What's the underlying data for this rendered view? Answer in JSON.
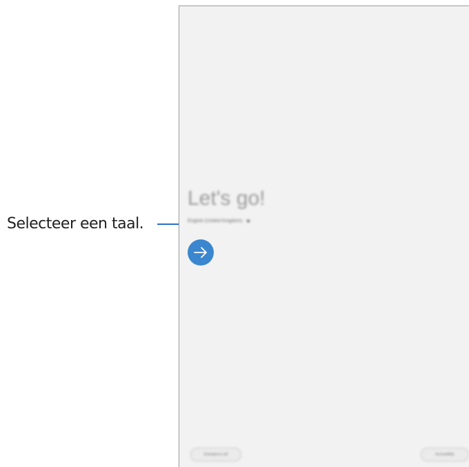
{
  "callout": {
    "text": "Selecteer een taal."
  },
  "screen": {
    "headline": "Let's go!",
    "language": {
      "selected": "English (United Kingdom)"
    },
    "next_icon": "arrow-right-icon",
    "footer": {
      "emergency_label": "Emergency call",
      "accessibility_label": "Accessibility"
    }
  },
  "colors": {
    "accent": "#3a86cf",
    "callout_line": "#2a6fc8",
    "screen_background": "#f2f2f2"
  }
}
